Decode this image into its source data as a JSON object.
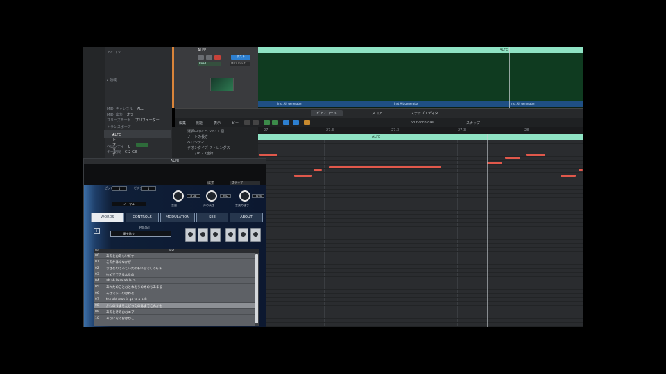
{
  "inspector": {
    "region_label": "▸ 領域",
    "track_label": "▾ トラック",
    "track_value": "ALFE",
    "rows": [
      {
        "k": "アイコン",
        "v": ""
      },
      {
        "k": "MIDI チャンネル",
        "v": "ALL"
      },
      {
        "k": "MIDI 出力",
        "v": "オフ"
      },
      {
        "k": "フリーズモード",
        "v": "プリフェーダー"
      },
      {
        "k": "トランスポーズ",
        "v": ""
      },
      {
        "k": "ベロシティ",
        "v": "0"
      },
      {
        "k": "キー制限",
        "v": "C-2  G8"
      },
      {
        "k": "ベロシティ制限",
        "v": "1  127"
      },
      {
        "k": "ディレイ",
        "v": ""
      }
    ]
  },
  "track": {
    "name": "ALFE",
    "badge": "ホスト",
    "instrument": "Read",
    "mode": "MIDI Input"
  },
  "arrange": {
    "ruler_label": "ALFE",
    "foot_labels": [
      "Inst Alt generator",
      "Inst Alt generator",
      "Inst Alt generator"
    ]
  },
  "editor": {
    "tabs": [
      "ピアノロール",
      "スコア",
      "ステップエディタ"
    ],
    "menus": [
      "編集",
      "機能",
      "表示",
      "ピー"
    ],
    "snap_label": "スナップ",
    "position": "5o  rv.cco  das",
    "ruler_ticks": [
      "27",
      "27.3",
      "27.3",
      "27.3",
      "28"
    ],
    "region_label": "ALFE",
    "left_labels": [
      "選択中のイベント: 1 個",
      "ノートの長さ",
      "ベロシティ",
      "クオンタイズ ストレングス",
      "1/16 - 3連符"
    ]
  },
  "plugin": {
    "title": "ALFE",
    "edit_label": "編集",
    "edit_value": "ステップ",
    "view_label": "表示",
    "knobs": [
      {
        "label": "音量",
        "value": "0 dB"
      },
      {
        "label": "声の高さ",
        "value": "0%"
      },
      {
        "label": "言葉の速さ",
        "value": "100%"
      }
    ],
    "small_labels": [
      "ピッチ",
      "ビブラート"
    ],
    "small_values": [
      "0",
      "0"
    ],
    "mode_value": "ノーマル",
    "tabs": [
      "WORDS",
      "CONTROLS",
      "MODULATION",
      "SEE",
      "ABOUT"
    ],
    "preset_label": "PRESET",
    "preset_value": "歌を歌う",
    "list_headers": [
      "No.",
      "Text"
    ],
    "words": [
      {
        "no": "00",
        "text": "あのとおあもいだす"
      },
      {
        "no": "01",
        "text": "このかはくなかが"
      },
      {
        "no": "02",
        "text": "きせをのばっていたのもいるでしてもま"
      },
      {
        "no": "03",
        "text": "ゆめでできるんるの"
      },
      {
        "no": "04",
        "text": "ah ah la ra ah la ta"
      },
      {
        "no": "05",
        "text": "あわたのことおとれおうのめのちあまる"
      },
      {
        "no": "06",
        "text": "そばでまいのはねを"
      },
      {
        "no": "07",
        "text": "the old man is go to a ock"
      },
      {
        "no": "08",
        "text": "かわのうまをたどったのはまでこんかも"
      },
      {
        "no": "09",
        "text": "あのときのおおエア"
      },
      {
        "no": "10",
        "text": "あなにをておはかこ"
      }
    ],
    "selected_index": 8
  }
}
